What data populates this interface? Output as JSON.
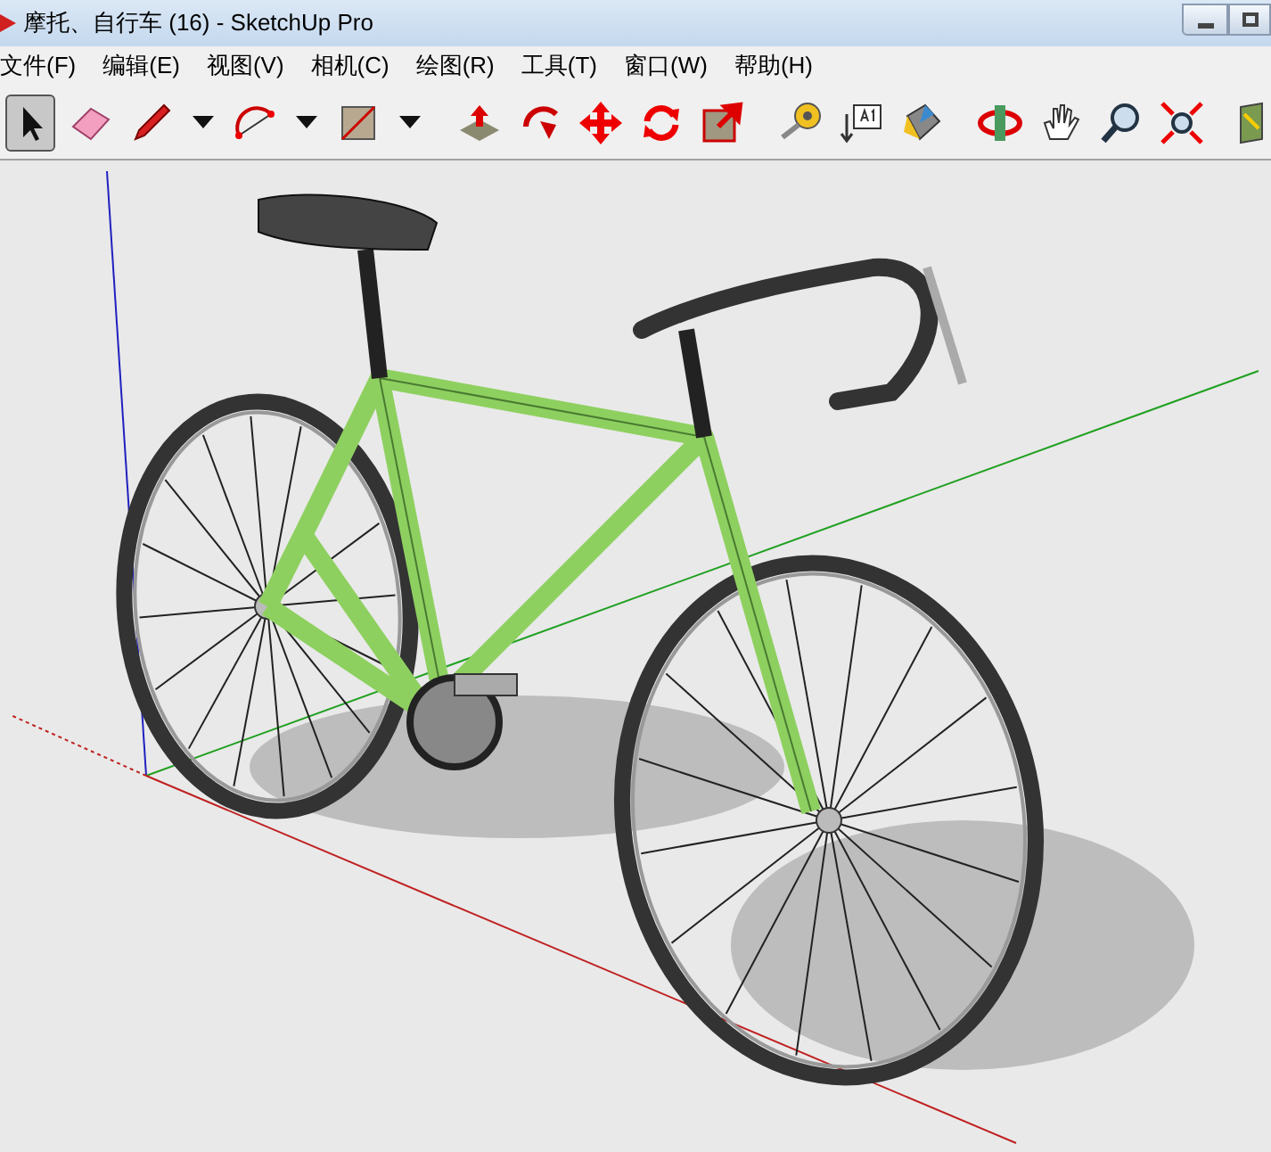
{
  "window": {
    "title": "摩托、自行车 (16) - SketchUp Pro"
  },
  "menu": [
    "文件(F)",
    "编辑(E)",
    "视图(V)",
    "相机(C)",
    "绘图(R)",
    "工具(T)",
    "窗口(W)",
    "帮助(H)"
  ],
  "toolbar": [
    {
      "kind": "select",
      "selected": true
    },
    {
      "kind": "eraser",
      "selected": false
    },
    {
      "kind": "pencil",
      "selected": false
    },
    {
      "kind": "dropdown",
      "selected": false
    },
    {
      "kind": "arc",
      "selected": false
    },
    {
      "kind": "dropdown",
      "selected": false
    },
    {
      "kind": "rectangle",
      "selected": false
    },
    {
      "kind": "dropdown",
      "selected": false
    },
    {
      "kind": "separator"
    },
    {
      "kind": "pushpull",
      "selected": false
    },
    {
      "kind": "followme",
      "selected": false
    },
    {
      "kind": "move",
      "selected": false
    },
    {
      "kind": "rotate",
      "selected": false
    },
    {
      "kind": "scale",
      "selected": false
    },
    {
      "kind": "separator"
    },
    {
      "kind": "tape",
      "selected": false
    },
    {
      "kind": "text",
      "selected": false
    },
    {
      "kind": "paint",
      "selected": false
    },
    {
      "kind": "separator"
    },
    {
      "kind": "orbit",
      "selected": false
    },
    {
      "kind": "pan",
      "selected": false
    },
    {
      "kind": "zoom",
      "selected": false
    },
    {
      "kind": "extents",
      "selected": false
    },
    {
      "kind": "separator"
    },
    {
      "kind": "map",
      "selected": false
    }
  ]
}
